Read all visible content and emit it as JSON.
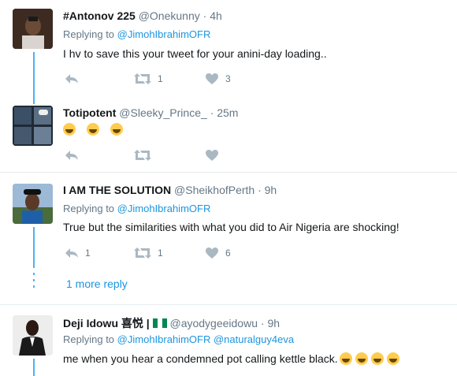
{
  "tweets": [
    {
      "name": "#Antonov 225",
      "handle": "@Onekunny",
      "time": "· 4h",
      "replying_label": "Replying to",
      "replying_to": "@JimohIbrahimOFR",
      "text": "I hv to save this your tweet for your anini-day loading..",
      "retweets": "1",
      "likes": "3"
    },
    {
      "name": "Totipotent",
      "handle": "@Sleeky_Prince_",
      "time": "· 25m",
      "emojis": [
        "face-with-tears-of-joy",
        "face-with-tears-of-joy",
        "face-with-tears-of-joy"
      ]
    },
    {
      "name": "I AM THE SOLUTION",
      "handle": "@SheikhofPerth",
      "time": "· 9h",
      "replying_label": "Replying to",
      "replying_to": "@JimohIbrahimOFR",
      "text": "True but the similarities with what you did to Air Nigeria are shocking!",
      "replies": "1",
      "retweets": "1",
      "likes": "6"
    },
    {
      "name": "Deji Idowu 喜悦 |",
      "handle": "@ayodygeeidowu",
      "time": "· 9h",
      "replying_label": "Replying to",
      "replying_to": "@JimohIbrahimOFR",
      "replying_to_2": "@naturalguy4eva",
      "text": "me when you hear a condemned pot calling kettle black.",
      "trailing_emojis": [
        "rolling-on-floor-laughing",
        "rolling-on-floor-laughing",
        "rolling-on-floor-laughing",
        "rolling-on-floor-laughing"
      ]
    }
  ],
  "more_replies": "1 more reply",
  "colors": {
    "accent": "#1b95e0",
    "thread": "#4ab3f4",
    "muted": "#657786",
    "icon": "#aab8c2"
  }
}
